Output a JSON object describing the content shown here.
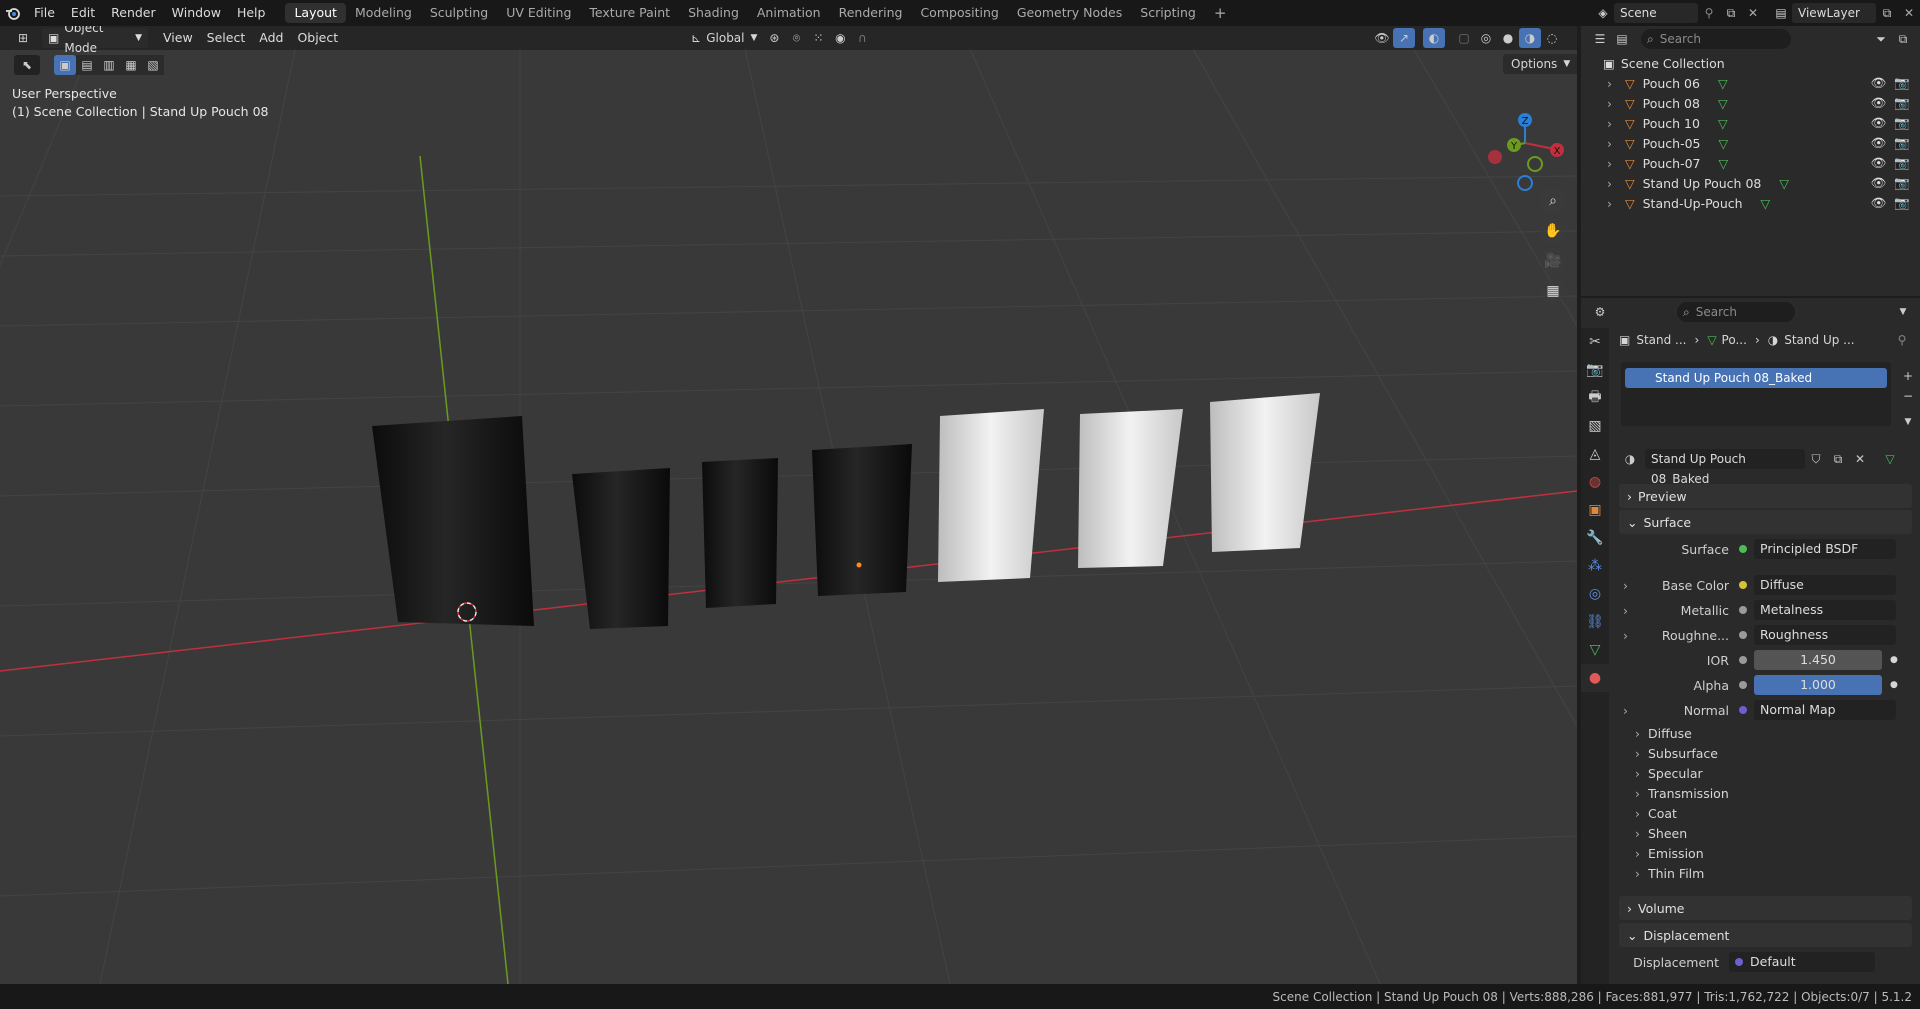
{
  "topbar": {
    "menus": [
      "File",
      "Edit",
      "Render",
      "Window",
      "Help"
    ],
    "workspaces": [
      "Layout",
      "Modeling",
      "Sculpting",
      "UV Editing",
      "Texture Paint",
      "Shading",
      "Animation",
      "Rendering",
      "Compositing",
      "Geometry Nodes",
      "Scripting"
    ],
    "active_workspace": "Layout",
    "add_tab": "+",
    "scene_name": "Scene",
    "view_layer": "ViewLayer"
  },
  "viewport": {
    "mode": "Object Mode",
    "menus": [
      "View",
      "Select",
      "Add",
      "Object"
    ],
    "transform_orientation": "Global",
    "options_label": "Options",
    "overlay_line1": "User Perspective",
    "overlay_line2": "(1) Scene Collection | Stand Up Pouch 08",
    "gizmo": {
      "x": "X",
      "y": "Y",
      "z": "Z"
    },
    "colors": {
      "x_axis": "#c0303f",
      "y_axis": "#6a9b1e",
      "z_axis": "#2a7fd6",
      "floor": "#393939"
    }
  },
  "outliner": {
    "search_placeholder": "Search",
    "root": "Scene Collection",
    "items": [
      "Pouch 06",
      "Pouch 08",
      "Pouch 10",
      "Pouch-05",
      "Pouch-07",
      "Stand Up Pouch 08",
      "Stand-Up-Pouch"
    ]
  },
  "properties": {
    "search_placeholder": "Search",
    "breadcrumb": [
      "Stand ...",
      "Po...",
      "Stand Up ..."
    ],
    "material_slot": "Stand Up Pouch 08_Baked",
    "material_name": "Stand Up Pouch 08_Baked",
    "panels": {
      "preview": "Preview",
      "surface": "Surface",
      "volume": "Volume",
      "displacement": "Displacement"
    },
    "surface_rows": [
      {
        "label": "Surface",
        "value": "Principled BSDF",
        "color": "#4cbd56"
      },
      {
        "label": "Base Color",
        "value": "Diffuse",
        "color": "#d6c23a"
      },
      {
        "label": "Metallic",
        "value": "Metalness",
        "color": "#9a9a9a"
      },
      {
        "label": "Roughne...",
        "value": "Roughness",
        "color": "#9a9a9a"
      },
      {
        "label": "IOR",
        "value": "1.450",
        "color": "#9a9a9a"
      },
      {
        "label": "Alpha",
        "value": "1.000",
        "color": "#9a9a9a"
      },
      {
        "label": "Normal",
        "value": "Normal Map",
        "color": "#6b5fd1"
      }
    ],
    "subpanels": [
      "Diffuse",
      "Subsurface",
      "Specular",
      "Transmission",
      "Coat",
      "Sheen",
      "Emission",
      "Thin Film"
    ],
    "displacement_row": {
      "label": "Displacement",
      "value": "Default",
      "color": "#6b5fd1"
    },
    "accent": "#4772b3"
  },
  "statusbar": {
    "text": "Scene Collection | Stand Up Pouch 08 | Verts:888,286 | Faces:881,977 | Tris:1,762,722 | Objects:0/7 | 5.1.2"
  }
}
